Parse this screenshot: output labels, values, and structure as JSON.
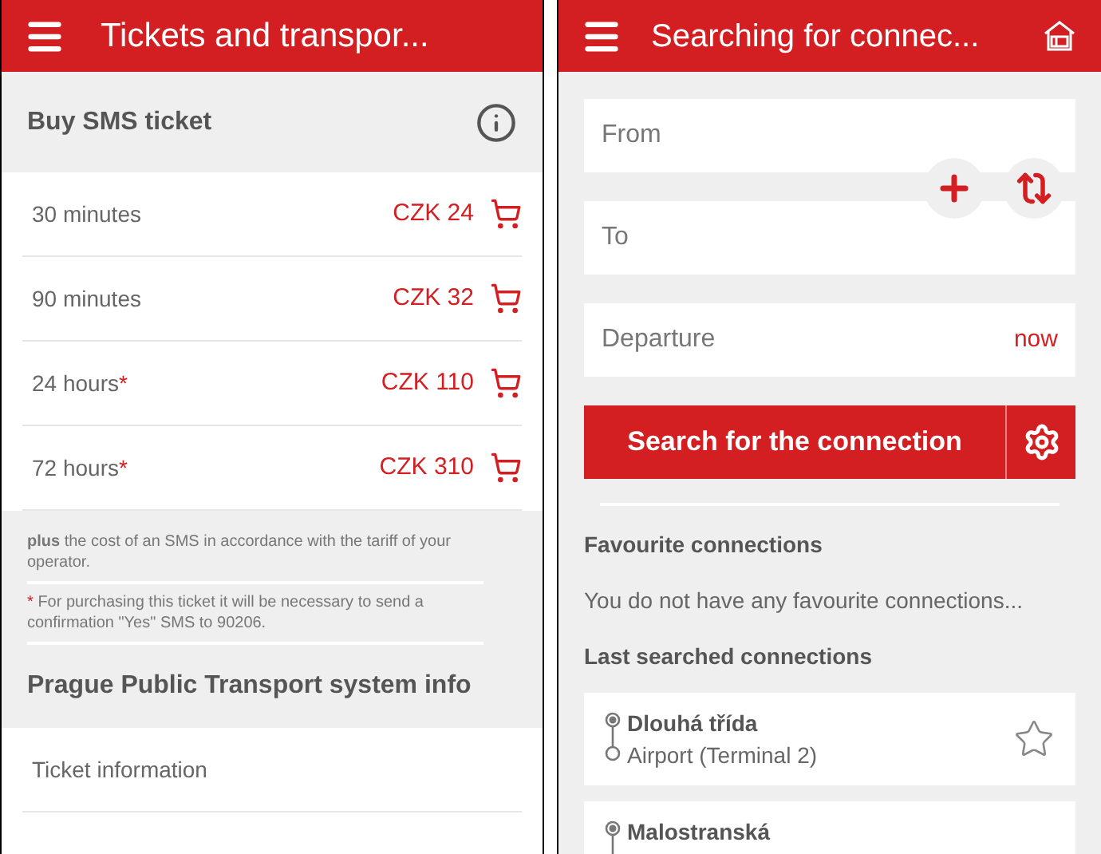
{
  "tickets_screen": {
    "title": "Tickets and transpor...",
    "sms_section": {
      "heading": "Buy SMS ticket"
    },
    "tickets": [
      {
        "duration": "30 minutes",
        "price": "CZK 24"
      },
      {
        "duration": "90 minutes",
        "price": "CZK 32"
      },
      {
        "duration": "24 hours",
        "note_mark": "*",
        "price": "CZK 110"
      },
      {
        "duration": "72 hours",
        "note_mark": "*",
        "price": "CZK 310"
      }
    ],
    "notes": [
      {
        "text": "**plus**  the cost of an SMS in accordance with the tariff of your operator."
      },
      {
        "mark": "*",
        "text": "For purchasing this ticket it will be necessary to send a confirmation \"Yes\" SMS to 90206."
      }
    ],
    "info_section": {
      "heading": "Prague Public Transport system info"
    },
    "info_items": [
      "Ticket information"
    ]
  },
  "search_screen": {
    "title": "Searching for connec...",
    "from": {
      "placeholder": "From"
    },
    "to": {
      "placeholder": "To"
    },
    "departure": {
      "label": "Departure",
      "value": "now"
    },
    "search_button": "Search for the connection",
    "favourites": {
      "heading": "Favourite connections",
      "empty_text": "You do not have any favourite connections..."
    },
    "recent": {
      "heading": "Last searched connections",
      "items": [
        {
          "from": "Dlouhá třída",
          "to": "Airport (Terminal 2)",
          "favourite": false
        },
        {
          "from": "Malostranská"
        }
      ]
    }
  }
}
